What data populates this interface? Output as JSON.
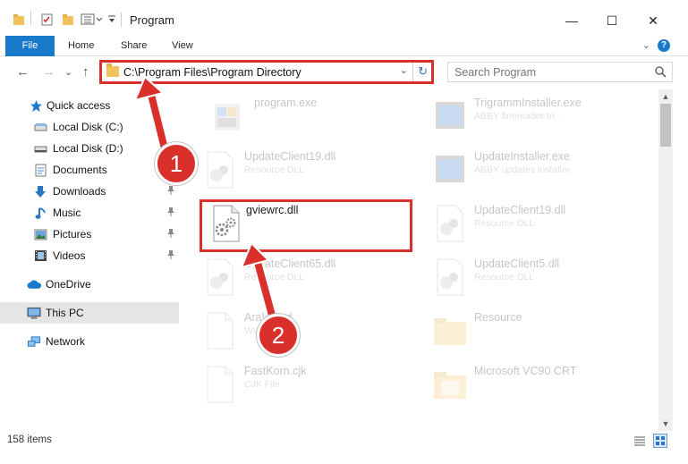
{
  "window": {
    "title": "Program",
    "minimize_glyph": "—",
    "maximize_glyph": "☐",
    "close_glyph": "✕"
  },
  "ribbon": {
    "tabs": [
      "File",
      "Home",
      "Share",
      "View"
    ],
    "help": "?",
    "expand_glyph": "⌄"
  },
  "navigation": {
    "back": "←",
    "forward": "→",
    "recent": "⌄",
    "up": "↑",
    "address": "C:\\Program Files\\Program Directory",
    "address_dropdown": "⌄",
    "refresh": "↻",
    "search_placeholder": "Search Program"
  },
  "sidebar": {
    "items": [
      {
        "label": "Quick access",
        "icon": "star-icon",
        "pinned": false
      },
      {
        "label": "Local Disk (C:)",
        "icon": "drive-icon",
        "pinned": false
      },
      {
        "label": "Local Disk (D:)",
        "icon": "drive-icon",
        "pinned": false
      },
      {
        "label": "Documents",
        "icon": "document-icon",
        "pinned": false
      },
      {
        "label": "Downloads",
        "icon": "download-icon",
        "pinned": true
      },
      {
        "label": "Music",
        "icon": "music-icon",
        "pinned": true
      },
      {
        "label": "Pictures",
        "icon": "pictures-icon",
        "pinned": true
      },
      {
        "label": "Videos",
        "icon": "videos-icon",
        "pinned": true
      },
      {
        "label": "OneDrive",
        "icon": "cloud-icon",
        "pinned": false
      },
      {
        "label": "This PC",
        "icon": "computer-icon",
        "pinned": false,
        "selected": true
      },
      {
        "label": "Network",
        "icon": "network-icon",
        "pinned": false
      }
    ],
    "pin_glyph": "📌"
  },
  "files": [
    {
      "name": "program.exe",
      "desc": "",
      "icon": "program-icon"
    },
    {
      "name": "TrigrammInstaller.exe",
      "desc": "ABBY finereader tri...",
      "icon": "installer-icon"
    },
    {
      "name": "UpdateClient19.dll",
      "desc": "Resource DLL",
      "icon": "dll-icon"
    },
    {
      "name": "UpdateInstaller.exe",
      "desc": "ABBY updates installer",
      "icon": "installer-icon"
    },
    {
      "name": "gviewrc.dll",
      "desc": "",
      "icon": "dll-icon",
      "highlighted": true
    },
    {
      "name": "UpdateClient19.dll",
      "desc": "Resource DLL",
      "icon": "dll-icon"
    },
    {
      "name": "UpdateClient65.dll",
      "desc": "Resource DLL",
      "icon": "dll-icon"
    },
    {
      "name": "UpdateClient5.dll",
      "desc": "Resource DLL",
      "icon": "dll-icon"
    },
    {
      "name": "AraIstand",
      "desc": "WW File",
      "icon": "blank-file-icon"
    },
    {
      "name": "Resource",
      "desc": "",
      "icon": "folder-icon"
    },
    {
      "name": "FastKorn.cjk",
      "desc": "CJK File",
      "icon": "blank-file-icon"
    },
    {
      "name": "Microsoft VC90 CRT",
      "desc": "",
      "icon": "folder-icon"
    }
  ],
  "annotations": {
    "step1": "1",
    "step2": "2",
    "color": "#d9302c"
  },
  "status": {
    "count": "158 items"
  },
  "colors": {
    "accent": "#1979ca",
    "folder": "#f3c35b",
    "highlight": "#d9302c",
    "selected_nav": "#e5e5e5"
  }
}
